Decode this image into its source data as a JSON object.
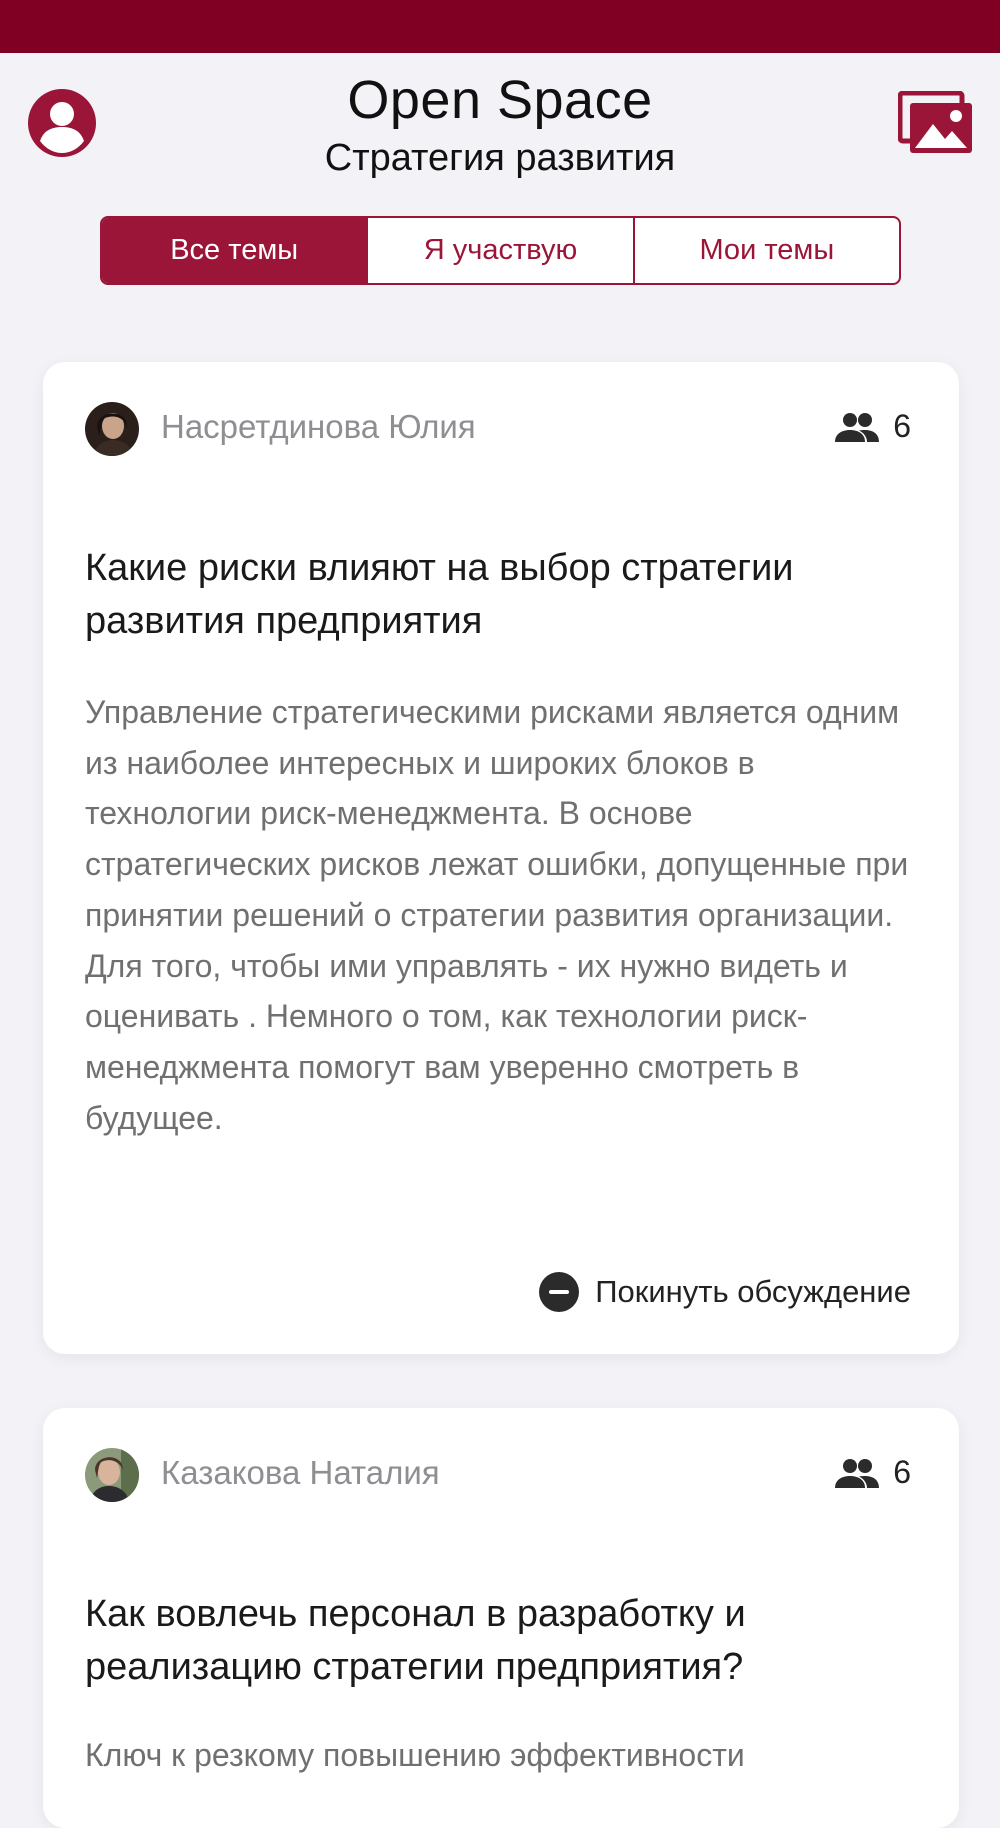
{
  "header": {
    "title": "Open Space",
    "subtitle": "Стратегия развития",
    "profile_icon": "user-circle-icon",
    "gallery_icon": "images-icon"
  },
  "tabs": [
    {
      "label": "Все темы",
      "active": true
    },
    {
      "label": "Я участвую",
      "active": false
    },
    {
      "label": "Мои темы",
      "active": false
    }
  ],
  "topics": [
    {
      "author": "Насретдинова Юлия",
      "participants": "6",
      "title": "Какие риски влияют на выбор стратегии развития предприятия",
      "description": "Управление стратегическими рисками является одним из наиболее интересных и широких блоков в технологии риск-менеджмента. В основе стратегических рисков лежат ошибки, допущенные при принятии решений о стратегии развития организации. Для того, чтобы ими управлять - их нужно видеть и оценивать . Немного о том, как технологии риск-менеджмента помогут вам уверенно смотреть в будущее.",
      "action_label": "Покинуть обсуждение"
    },
    {
      "author": "Казакова Наталия",
      "participants": "6",
      "title": "Как вовлечь персонал в разработку и реализацию стратегии предприятия?",
      "description": "Ключ к резкому повышению эффективности"
    }
  ],
  "colors": {
    "brand": "#800024",
    "accent": "#9a1537",
    "background": "#f2f2f7"
  }
}
